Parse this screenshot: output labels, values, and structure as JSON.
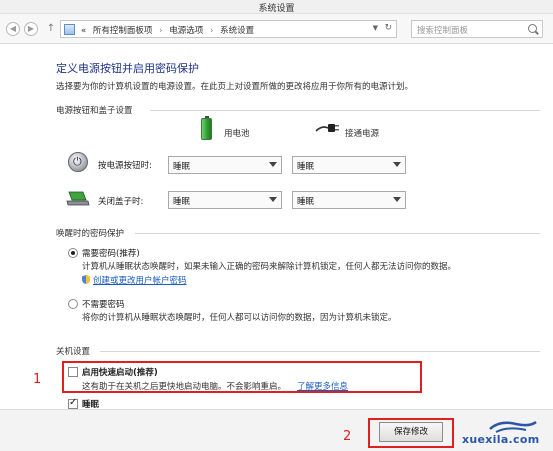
{
  "window": {
    "title": "系统设置"
  },
  "nav": {
    "breadcrumbs": [
      "所有控制面板项",
      "电源选项",
      "系统设置"
    ],
    "prefix": "«",
    "separator": "›",
    "search_placeholder": "搜索控制面板"
  },
  "page": {
    "title": "定义电源按钮并启用密码保护",
    "description": "选择要为你的计算机设置的电源设置。在此页上对设置所做的更改将应用于你所有的电源计划。"
  },
  "power_buttons": {
    "section_title": "电源按钮和盖子设置",
    "col_battery": "用电池",
    "col_plugged": "接通电源",
    "rows": [
      {
        "label": "按电源按钮时:",
        "battery": "睡眠",
        "plugged": "睡眠"
      },
      {
        "label": "关闭盖子时:",
        "battery": "睡眠",
        "plugged": "睡眠"
      }
    ]
  },
  "wakeup": {
    "section_title": "唤醒时的密码保护",
    "require": {
      "label": "需要密码(推荐)",
      "desc1": "计算机从睡眠状态唤醒时，如果未输入正确的密码来解除计算机锁定，任何人都无法访问你的数据。",
      "link": "创建或更改用户帐户密码"
    },
    "norequire": {
      "label": "不需要密码",
      "desc": "将你的计算机从睡眠状态唤醒时，任何人都可以访问你的数据，因为计算机未锁定。"
    }
  },
  "shutdown": {
    "section_title": "关机设置",
    "fast_startup": {
      "label": "启用快速启动(推荐)",
      "desc": "这有助于在关机之后更快地启动电脑。不会影响重启。",
      "link": "了解更多信息"
    },
    "sleep": {
      "label": "睡眠"
    }
  },
  "footer": {
    "save_label": "保存修改"
  },
  "annotations": {
    "one": "1",
    "two": "2"
  },
  "watermark": {
    "text": "xuexila.com"
  },
  "colors": {
    "title_blue": "#1e3287",
    "link_blue": "#1a5cbf",
    "annotation_red": "#e02020"
  }
}
